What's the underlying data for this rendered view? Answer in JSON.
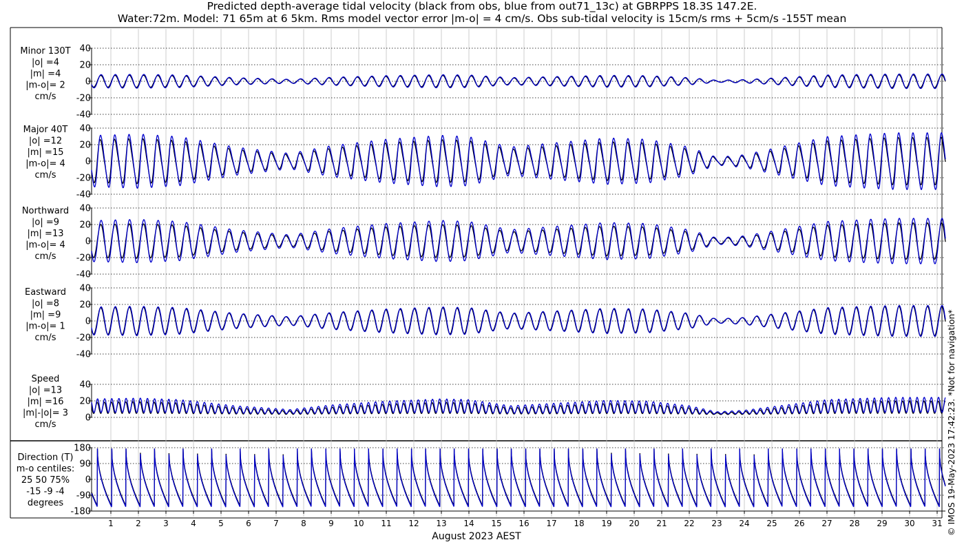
{
  "title_line1": "Predicted depth-average tidal velocity (black from obs, blue from out71_13c) at GBRPPS 18.3S 147.2E.",
  "title_line2": "Water:72m. Model: 71 65m at 6 5km. Rms model vector error |m-o| = 4 cm/s. Obs sub-tidal velocity is 15cm/s rms + 5cm/s -155T mean",
  "credit": "© IMOS 19-May-2023 17:42:23.  *Not for navigation*",
  "colors": {
    "obs": "#000000",
    "model": "#0000cc",
    "grid": "#000000",
    "day_grid": "#c0c0c0"
  },
  "chart_data": {
    "type": "line",
    "xlabel": "August 2023 AEST",
    "x_unit": "day of August 2023",
    "xlim": [
      0.3,
      31.3
    ],
    "x_ticks": [
      1,
      2,
      3,
      4,
      5,
      6,
      7,
      8,
      9,
      10,
      11,
      12,
      13,
      14,
      15,
      16,
      17,
      18,
      19,
      20,
      21,
      22,
      23,
      24,
      25,
      26,
      27,
      28,
      29,
      30,
      31
    ],
    "series_legend": {
      "obs": "black from obs",
      "model": "blue from out71_13c"
    },
    "panels": [
      {
        "key": "minor",
        "label_lines": [
          "Minor 130T",
          "|o| =4",
          "|m| =4",
          "|m-o|= 2",
          "cm/s"
        ],
        "ylim": [
          -40,
          40
        ],
        "yticks": [
          -40,
          -20,
          0,
          20,
          40
        ],
        "obs_amplitude": 7,
        "model_amplitude": 8,
        "unit": "cm/s"
      },
      {
        "key": "major",
        "label_lines": [
          "Major 40T",
          "|o| =12",
          "|m| =15",
          "|m-o|= 4",
          "cm/s"
        ],
        "ylim": [
          -40,
          40
        ],
        "yticks": [
          -40,
          -20,
          0,
          20,
          40
        ],
        "obs_amplitude": 25,
        "model_amplitude": 30,
        "unit": "cm/s"
      },
      {
        "key": "north",
        "label_lines": [
          "Northward",
          "|o| =9",
          "|m| =13",
          "|m-o|= 4",
          "cm/s"
        ],
        "ylim": [
          -40,
          40
        ],
        "yticks": [
          -40,
          -20,
          0,
          20,
          40
        ],
        "obs_amplitude": 20,
        "model_amplitude": 25,
        "unit": "cm/s"
      },
      {
        "key": "east",
        "label_lines": [
          "Eastward",
          "|o| =8",
          "|m| =9",
          "|m-o|= 1",
          "cm/s"
        ],
        "ylim": [
          -40,
          40
        ],
        "yticks": [
          -40,
          -20,
          0,
          20,
          40
        ],
        "obs_amplitude": 16,
        "model_amplitude": 17,
        "unit": "cm/s"
      },
      {
        "key": "speed",
        "label_lines": [
          "Speed",
          "|o| =13",
          "|m| =16",
          "|m|-|o|= 3",
          "cm/s"
        ],
        "ylim": [
          0,
          40
        ],
        "yticks": [
          0,
          20,
          40
        ],
        "obs_mean": 13,
        "model_mean": 16,
        "unit": "cm/s"
      },
      {
        "key": "direction",
        "label_lines": [
          "Direction (T)",
          "m-o centiles:",
          "25  50  75%",
          "-15  -9  -4",
          "degrees"
        ],
        "ylim": [
          -180,
          180
        ],
        "yticks": [
          -180,
          -90,
          0,
          90,
          180
        ],
        "unit": "degrees T"
      }
    ],
    "envelope_days": [
      0.5,
      2,
      3.5,
      5.5,
      7.5,
      9,
      11,
      13,
      14,
      15.5,
      17,
      19,
      20.5,
      22,
      23,
      24,
      25.5,
      27,
      28.5,
      29.5,
      31
    ],
    "envelope_values": [
      1.0,
      1.05,
      0.95,
      0.55,
      0.3,
      0.6,
      0.85,
      1.0,
      0.95,
      0.55,
      0.7,
      0.9,
      0.85,
      0.55,
      0.15,
      0.25,
      0.6,
      0.95,
      1.05,
      1.1,
      1.1
    ]
  }
}
